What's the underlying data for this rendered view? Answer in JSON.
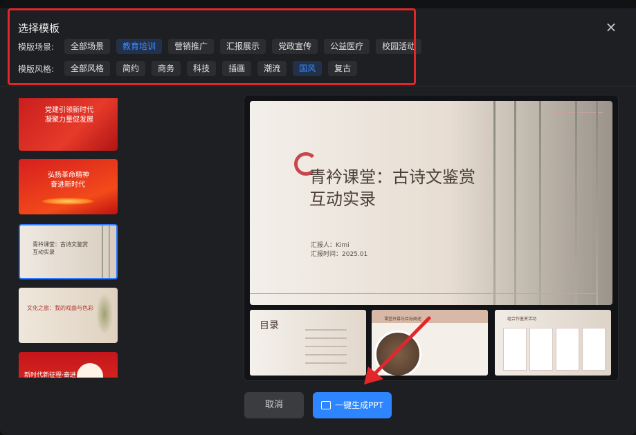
{
  "dialog": {
    "title": "选择模板",
    "close_symbol": "×"
  },
  "scene_filter": {
    "label": "模版场景:",
    "options": [
      "全部场景",
      "教育培训",
      "营销推广",
      "汇报展示",
      "党政宣传",
      "公益医疗",
      "校园活动"
    ],
    "selected": "教育培训"
  },
  "style_filter": {
    "label": "模版风格:",
    "options": [
      "全部风格",
      "简约",
      "商务",
      "科技",
      "插画",
      "潮流",
      "国风",
      "复古"
    ],
    "selected": "国风"
  },
  "templates": [
    {
      "title_lines": [
        "党建引领新时代",
        "凝聚力量促发展"
      ]
    },
    {
      "title_lines": [
        "弘扬革命精神",
        "奋进新时代"
      ]
    },
    {
      "title_lines": [
        "青衿课堂：古诗文鉴赏",
        "互动实录"
      ],
      "selected": true
    },
    {
      "title_lines": [
        "文化之旅：我的戏曲与色彩"
      ]
    },
    {
      "title_lines": [
        "新时代新征程·奋进"
      ]
    }
  ],
  "preview": {
    "title_line1": "青衿课堂：古诗文鉴赏",
    "title_line2": "互动实录",
    "reporter": "汇报人：Kimi",
    "report_time": "汇报时间：2025.01",
    "sub1_title": "目录",
    "sub2_title": "课堂开幕与目标阐述",
    "sub3_title": "组合作鉴赏活动"
  },
  "buttons": {
    "cancel": "取消",
    "generate": "一键生成PPT"
  },
  "colors": {
    "accent": "#2d86ff",
    "highlight_box": "#e3262a",
    "chip_active_text": "#3d8bff"
  }
}
